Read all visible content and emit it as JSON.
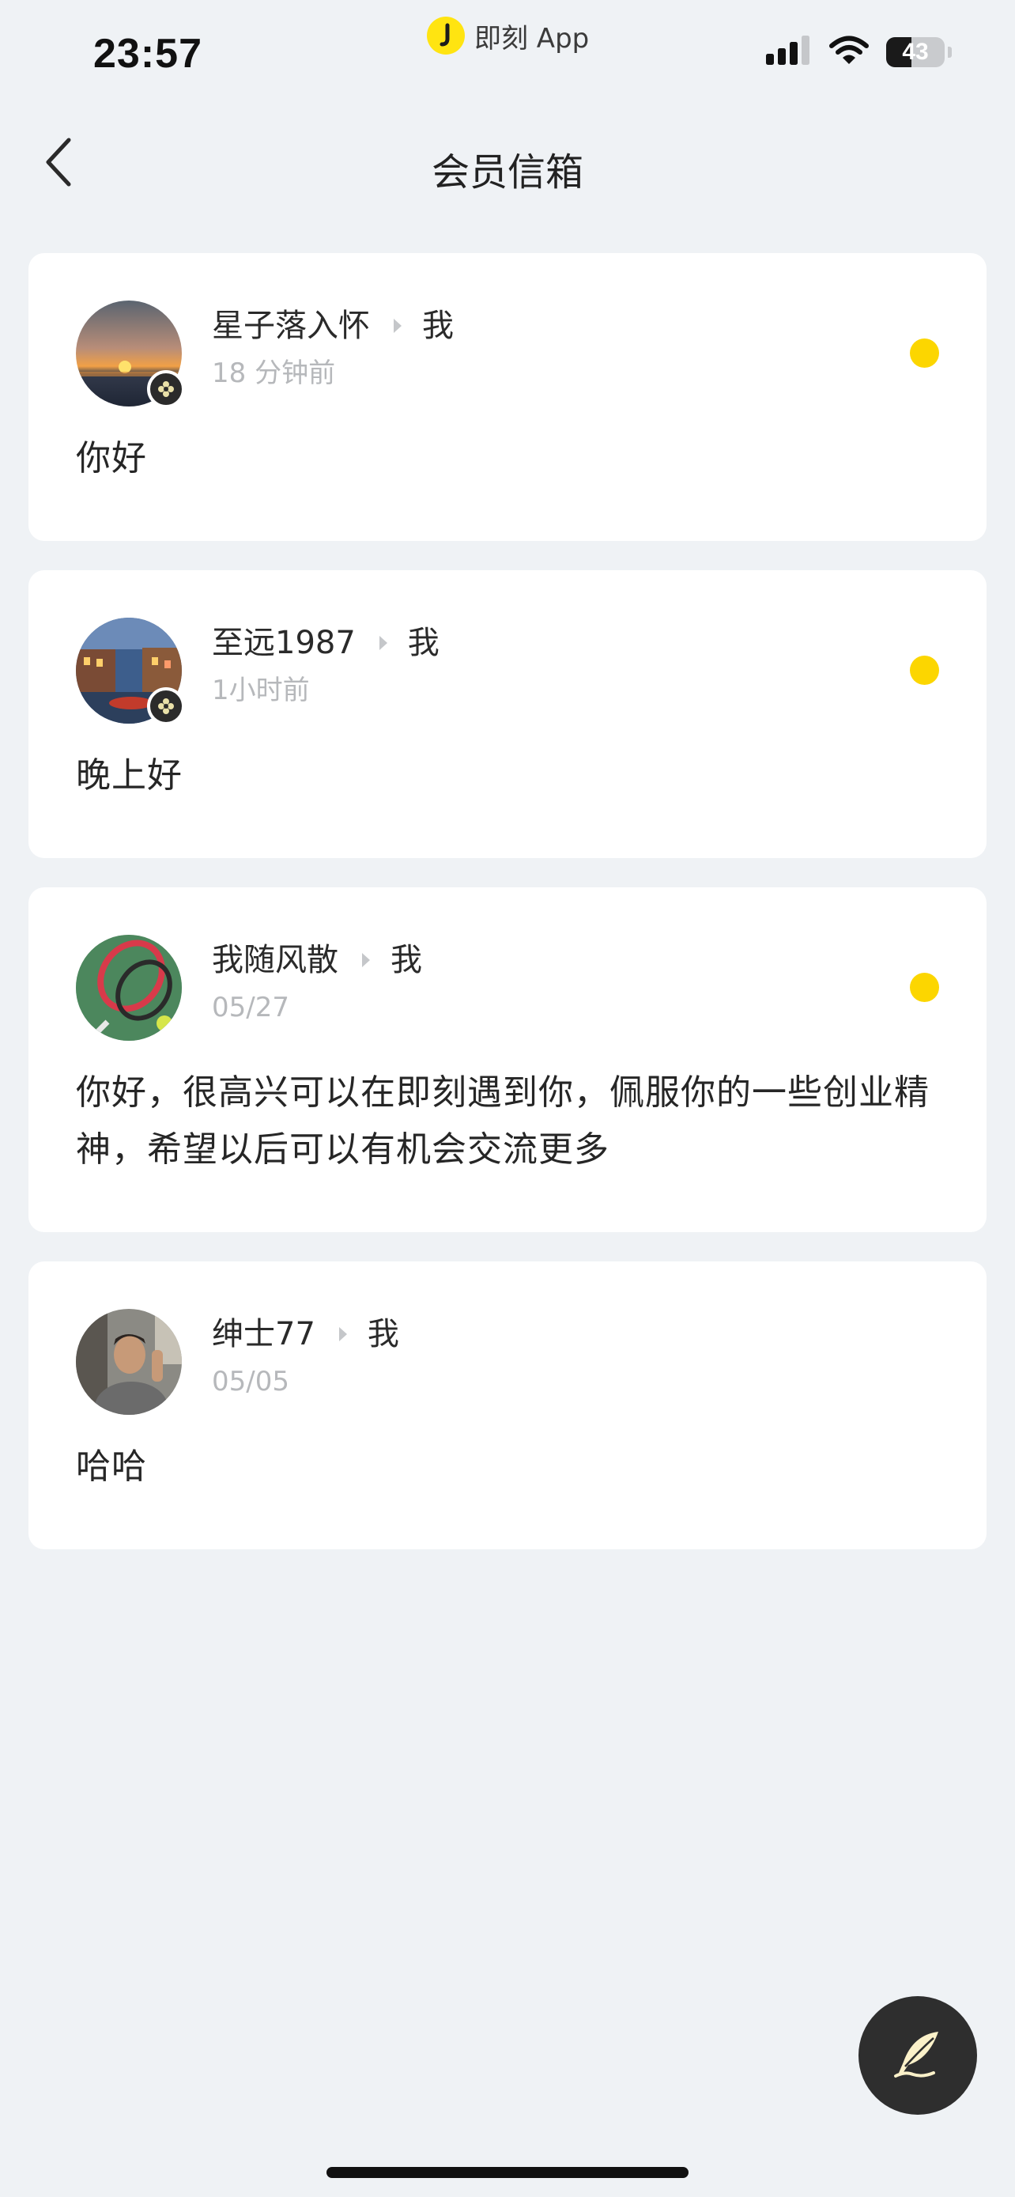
{
  "status_bar": {
    "time": "23:57",
    "app_indicator": "即刻 App",
    "battery_percent": 43,
    "battery_label": "43"
  },
  "nav": {
    "title": "会员信箱"
  },
  "messages": [
    {
      "sender": "星子落入怀",
      "recipient": "我",
      "time": "18 分钟前",
      "text": "你好",
      "unread": true,
      "avatar_badge": true
    },
    {
      "sender": "至远1987",
      "recipient": "我",
      "time": "1小时前",
      "text": "晚上好",
      "unread": true,
      "avatar_badge": true
    },
    {
      "sender": "我随风散",
      "recipient": "我",
      "time": "05/27",
      "text": "你好，很高兴可以在即刻遇到你，佩服你的一些创业精神，希望以后可以有机会交流更多",
      "unread": true,
      "avatar_badge": false
    },
    {
      "sender": "绅士77",
      "recipient": "我",
      "time": "05/05",
      "text": "哈哈",
      "unread": false,
      "avatar_badge": false
    }
  ],
  "colors": {
    "background": "#eff2f5",
    "card": "#ffffff",
    "accent_yellow": "#fcd600",
    "fab": "#2e2e2e"
  },
  "icons": {
    "back": "chevron-left-icon",
    "compose": "quill-pen-icon",
    "signal": "cellular-signal-icon",
    "wifi": "wifi-icon",
    "battery": "battery-icon"
  }
}
